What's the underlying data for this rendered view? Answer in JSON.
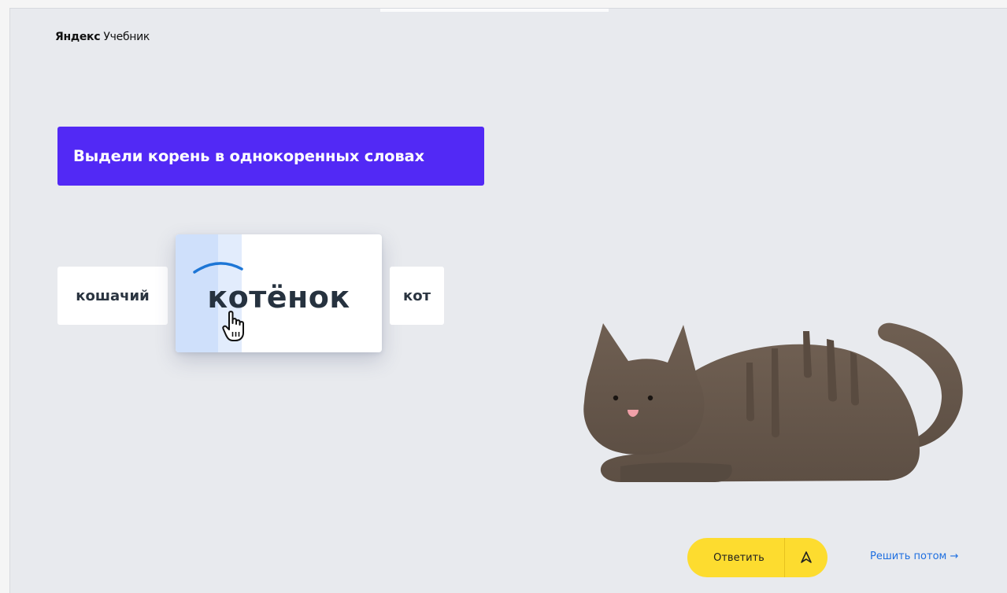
{
  "header": {
    "brand": "Яндекс",
    "product": "Учебник"
  },
  "task": {
    "title": "Выдели корень в однокоренных словах"
  },
  "words": {
    "left": "кошачий",
    "active": "котёнок",
    "right": "кот"
  },
  "actions": {
    "answer_label": "Ответить",
    "later_label": "Решить потом →"
  },
  "icons": {
    "answer_icon": "paper-plane-icon",
    "cursor": "hand-pointer-icon",
    "root_mark": "root-arc-icon"
  },
  "colors": {
    "banner": "#5229f5",
    "answer_button": "#fddc2f",
    "link": "#1e6fe0",
    "selection": "#cfe0fb",
    "root_arc": "#1d76d6",
    "cat_body": "#6b5b4e"
  }
}
